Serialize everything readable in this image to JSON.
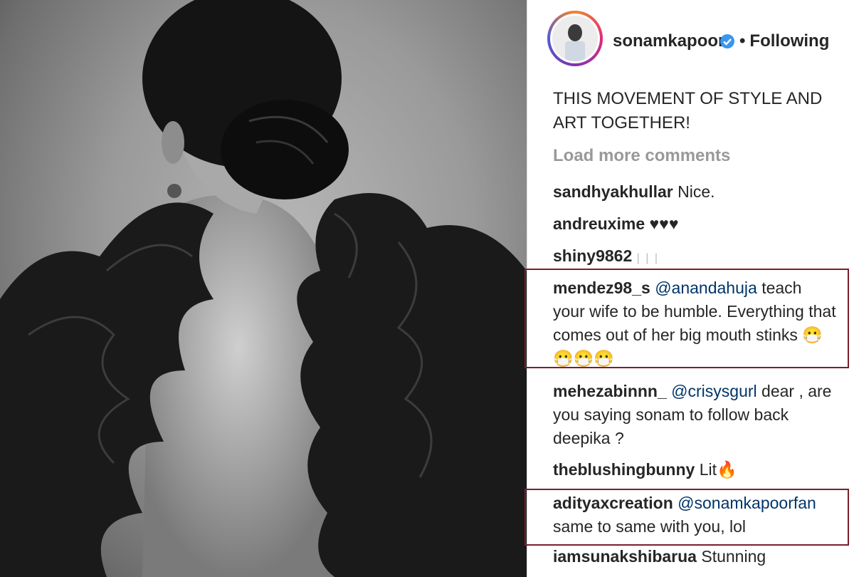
{
  "post": {
    "username": "sonamkapoor",
    "follow_status": "Following",
    "follow_separator": "•",
    "caption": "THIS MOVEMENT OF STYLE AND ART TOGETHER!",
    "load_more": "Load more comments"
  },
  "comments": [
    {
      "user": "sandhyakhullar",
      "mention": "",
      "text": "Nice."
    },
    {
      "user": "andreuxime",
      "mention": "",
      "text": "♥♥♥"
    },
    {
      "user": "shiny9862",
      "mention": "",
      "text": "| | |"
    },
    {
      "user": "mendez98_s",
      "mention": "@anandahuja",
      "text": "teach your wife to be humble. Everything that comes out of her big mouth stinks 😷😷😷😷"
    },
    {
      "user": "mehezabinnn_",
      "mention": "@crisysgurl",
      "text": "dear , are you saying sonam to follow back deepika ?"
    },
    {
      "user": "theblushingbunny",
      "mention": "",
      "text": "Lit🔥"
    },
    {
      "user": "adityaxcreation",
      "mention": "@sonamkapoorfan",
      "text": "same to same with you, lol"
    },
    {
      "user": "iamsunakshibarua",
      "mention": "",
      "text": "Stunning"
    }
  ],
  "colors": {
    "highlight_box": "#7a1f2b",
    "verified_badge": "#3897f0",
    "mention": "#003569"
  }
}
